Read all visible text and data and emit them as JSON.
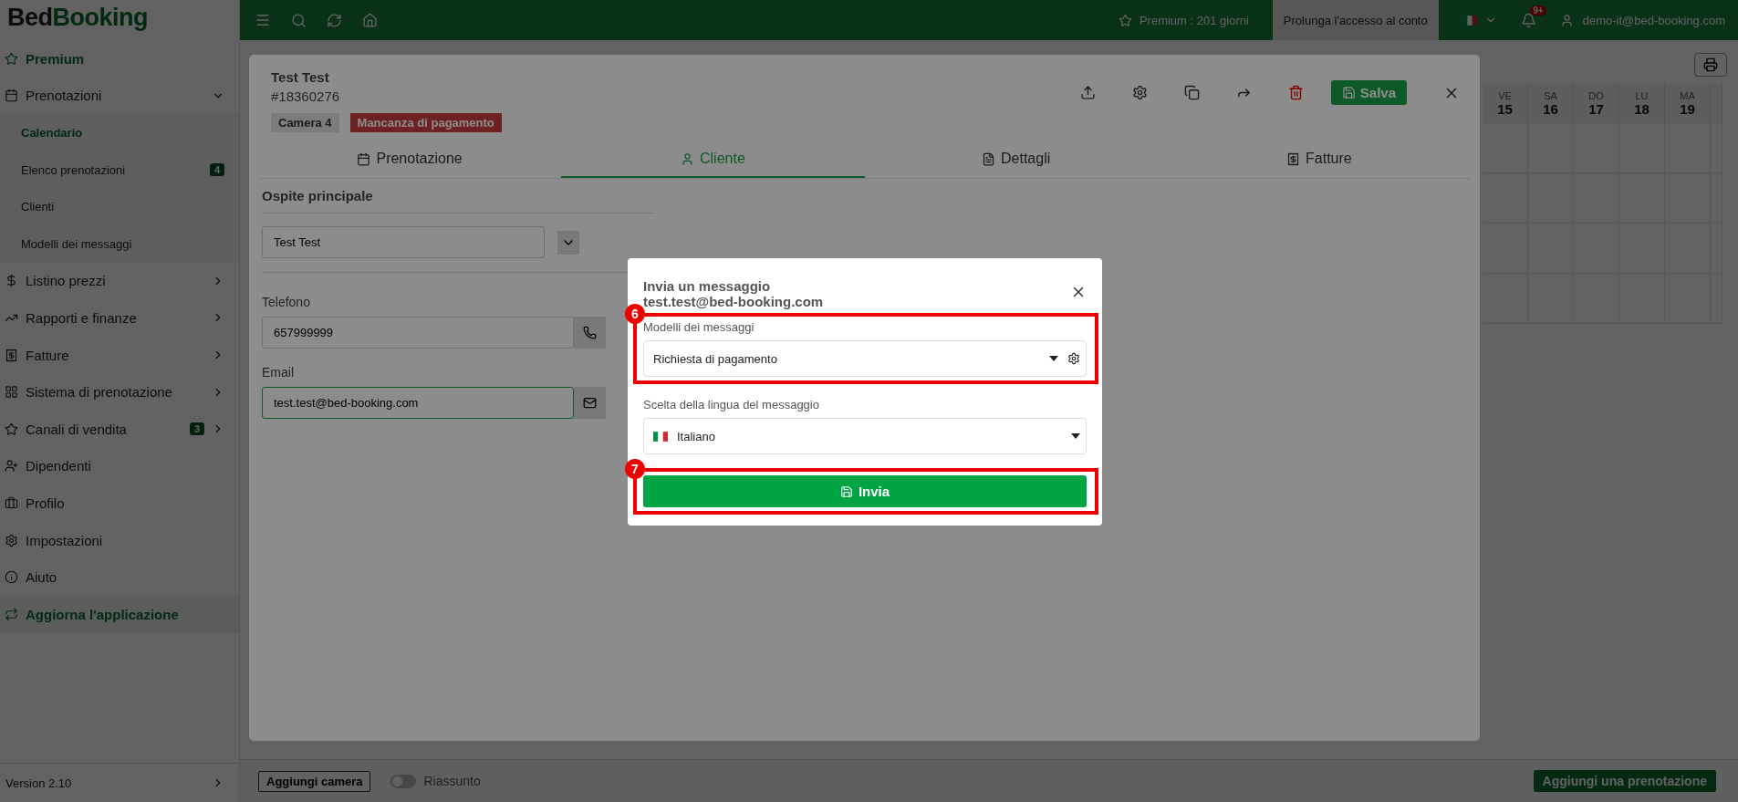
{
  "logo": {
    "first": "Bed",
    "second": "Booking"
  },
  "topbar": {
    "premium": "Premium : 201 giorni",
    "extend_button": "Prolunga l'accesso al conto",
    "notifications_badge": "9+",
    "user": "demo-it@bed-booking.com"
  },
  "sidebar": {
    "items": [
      {
        "label": "Premium",
        "kind": "promo",
        "selected": false
      },
      {
        "label": "Prenotazioni",
        "kind": "menu",
        "selected": false,
        "expanded": true,
        "children": [
          {
            "label": "Calendario",
            "selected": true
          },
          {
            "label": "Elenco prenotazioni",
            "selected": false,
            "badge": "4"
          },
          {
            "label": "Clienti",
            "selected": false
          },
          {
            "label": "Modelli dei messaggi",
            "selected": false
          }
        ]
      },
      {
        "label": "Listino prezzi",
        "kind": "menu",
        "selected": false,
        "expanded": false
      },
      {
        "label": "Rapporti e finanze",
        "kind": "menu",
        "selected": false,
        "expanded": false
      },
      {
        "label": "Fatture",
        "kind": "menu",
        "selected": false,
        "expanded": false
      },
      {
        "label": "Sistema di prenotazione",
        "kind": "menu",
        "selected": false,
        "expanded": false
      },
      {
        "label": "Canali di vendita",
        "kind": "menu",
        "selected": false,
        "expanded": false,
        "badge": "3"
      },
      {
        "label": "Dipendenti",
        "kind": "menu",
        "selected": false
      },
      {
        "label": "Profilo",
        "kind": "menu",
        "selected": false
      },
      {
        "label": "Impostazioni",
        "kind": "menu",
        "selected": false
      },
      {
        "label": "Aiuto",
        "kind": "menu",
        "selected": false
      },
      {
        "label": "Aggiorna l'applicazione",
        "kind": "update",
        "selected": false
      }
    ],
    "version": "Version 2.10"
  },
  "calendar": {
    "days": [
      {
        "weekday": "VE",
        "day": "15"
      },
      {
        "weekday": "SA",
        "day": "16"
      },
      {
        "weekday": "DO",
        "day": "17"
      },
      {
        "weekday": "LU",
        "day": "18"
      },
      {
        "weekday": "MA",
        "day": "19"
      }
    ]
  },
  "bottom_bar": {
    "add_room": "Aggiungi camera",
    "summary": {
      "label": "Riassunto",
      "on": false
    },
    "add_booking": "Aggiungi una prenotazione"
  },
  "booking": {
    "guest_name": "Test Test",
    "number": "#18360276",
    "tags": [
      {
        "label": "Camera 4",
        "kind": "room"
      },
      {
        "label": "Mancanza di pagamento",
        "kind": "warning"
      }
    ],
    "save": "Salva",
    "tabs": [
      {
        "label": "Prenotazione",
        "selected": false
      },
      {
        "label": "Cliente",
        "selected": true
      },
      {
        "label": "Dettagli",
        "selected": false
      },
      {
        "label": "Fatture",
        "selected": false
      }
    ],
    "section_title": "Ospite principale",
    "guest_field": "Test Test",
    "phone": {
      "label": "Telefono",
      "value": "657999999"
    },
    "email": {
      "label": "Email",
      "value": "test.test@bed-booking.com"
    }
  },
  "dialog": {
    "title": "Invia un messaggio",
    "recipient": "test.test@bed-booking.com",
    "template": {
      "label": "Modelli dei messaggi",
      "value": "Richiesta di pagamento",
      "annotation": "6"
    },
    "language": {
      "label": "Scelta della lingua del messaggio",
      "value": "Italiano"
    },
    "send": {
      "label": "Invia",
      "annotation": "7"
    }
  }
}
